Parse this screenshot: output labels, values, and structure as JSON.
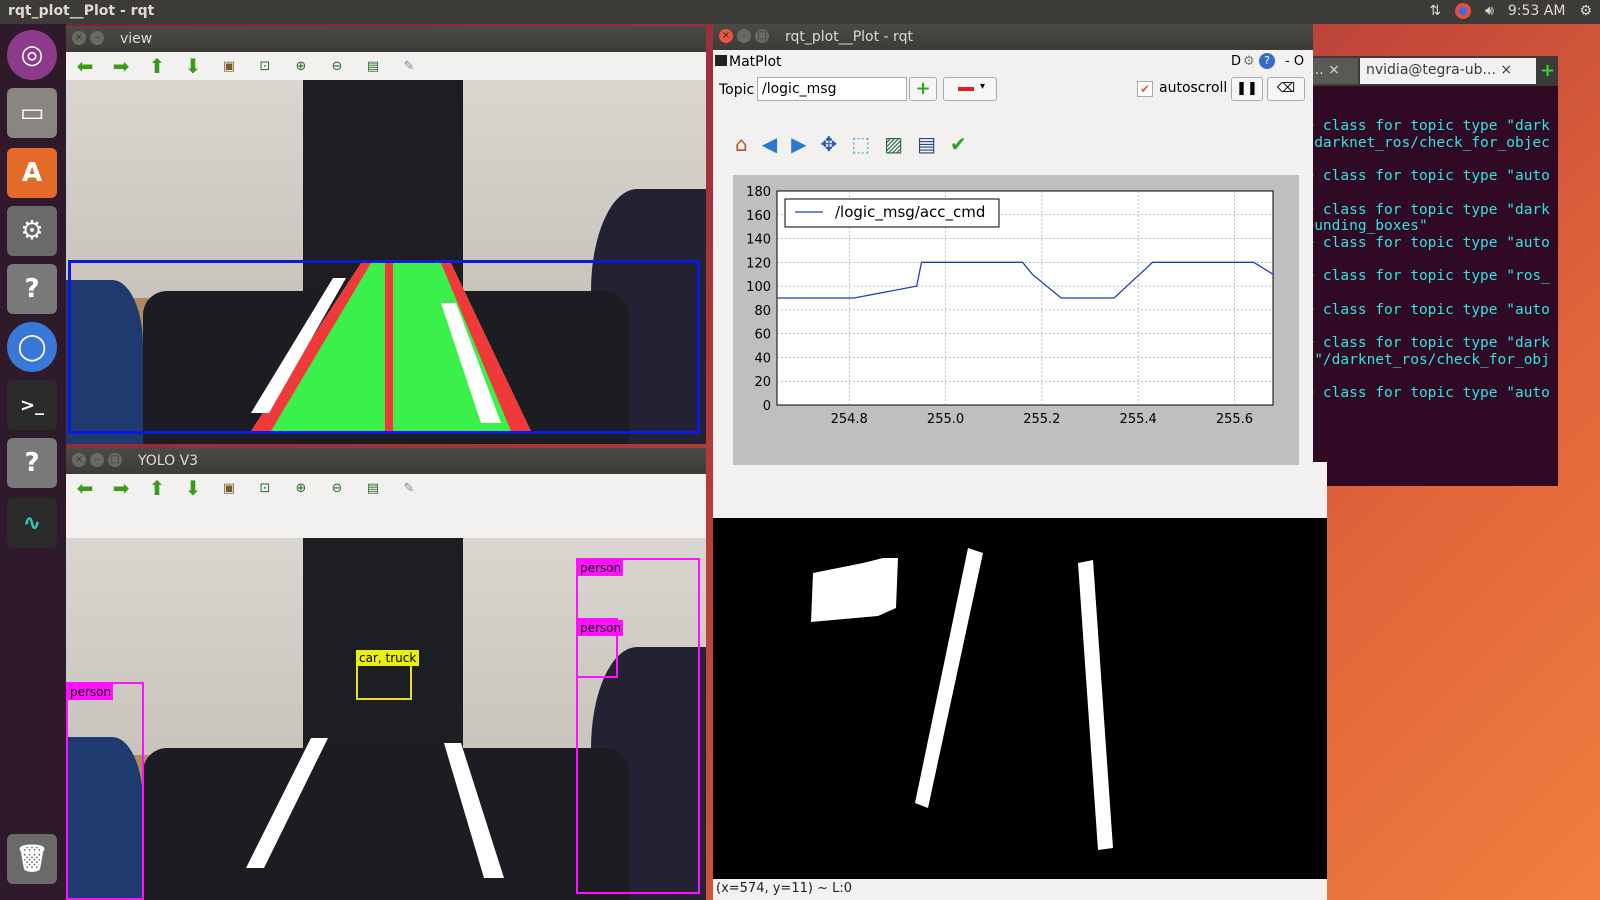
{
  "topbar": {
    "title": "rqt_plot__Plot - rqt",
    "time": "9:53 AM",
    "icons": [
      "network-icon",
      "keyboard-layout-icon",
      "volume-icon",
      "gear-icon"
    ]
  },
  "launcher": {
    "items": [
      "ubuntu-logo-icon",
      "files-icon",
      "software-center-icon",
      "settings-icon",
      "help-icon",
      "chromium-icon",
      "terminal-icon",
      "help-icon",
      "system-monitor-icon",
      "trash-icon"
    ]
  },
  "view_window": {
    "title": "view"
  },
  "yolo_window": {
    "title": "YOLO V3",
    "detections": [
      {
        "label": "person"
      },
      {
        "label": "person"
      },
      {
        "label": "car, truck"
      },
      {
        "label": "person"
      }
    ]
  },
  "plot_window": {
    "title": "rqt_plot__Plot - rqt",
    "plugin_name": "MatPlot",
    "plugin_controls": "D",
    "plugin_close": "- O",
    "topic_label": "Topic",
    "topic_value": "/logic_msg",
    "add_label": "+",
    "autoscroll_label": "autoscroll",
    "autoscroll_checked": true
  },
  "chart_data": {
    "type": "line",
    "title": "",
    "xlabel": "",
    "ylabel": "",
    "xlim": [
      254.65,
      255.68
    ],
    "ylim": [
      0,
      180
    ],
    "xticks": [
      254.8,
      255.0,
      255.2,
      255.4,
      255.6
    ],
    "yticks": [
      0,
      20,
      40,
      60,
      80,
      100,
      120,
      140,
      160,
      180
    ],
    "grid": true,
    "legend_position": "top-left",
    "series": [
      {
        "name": "/logic_msg/acc_cmd",
        "color": "#1f3fbf",
        "x": [
          254.65,
          254.81,
          254.94,
          254.95,
          255.16,
          255.18,
          255.24,
          255.35,
          255.43,
          255.64,
          255.68
        ],
        "y": [
          90,
          90,
          100,
          120,
          120,
          110,
          90,
          90,
          120,
          120,
          110
        ]
      }
    ]
  },
  "terminal": {
    "tabs": [
      "ca...",
      "nvidia@tegra-ub..."
    ],
    "lines": [
      "age class for topic type \"dark",
      " \"/darknet_ros/check_for_objec",
      "",
      "age class for topic type \"auto",
      "",
      "age class for topic type \"dark",
      "/bounding_boxes\"",
      "age class for topic type \"auto",
      "",
      "age class for topic type \"ros_",
      "",
      "age class for topic type \"auto",
      "",
      "age class for topic type \"dark",
      "ic \"/darknet_ros/check_for_obj",
      "",
      "age class for topic type \"auto"
    ]
  },
  "binary_view": {
    "status": "(x=574, y=11) ~ L:0"
  }
}
